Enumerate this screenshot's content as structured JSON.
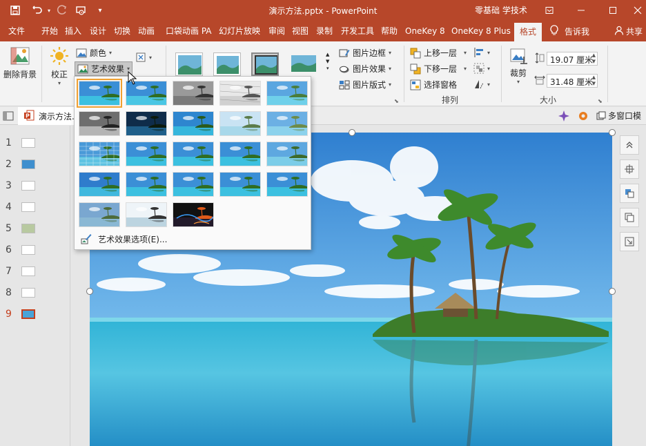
{
  "app": {
    "doc_title": "演示方法.pptx  -  PowerPoint",
    "user": "零基础 学技术"
  },
  "tabs": [
    {
      "label": "文件",
      "active": false
    },
    {
      "label": "开始",
      "active": false
    },
    {
      "label": "插入",
      "active": false
    },
    {
      "label": "设计",
      "active": false
    },
    {
      "label": "切换",
      "active": false
    },
    {
      "label": "动画",
      "active": false
    },
    {
      "label": "口袋动画 PA",
      "active": false
    },
    {
      "label": "幻灯片放映",
      "active": false
    },
    {
      "label": "审阅",
      "active": false
    },
    {
      "label": "视图",
      "active": false
    },
    {
      "label": "录制",
      "active": false
    },
    {
      "label": "开发工具",
      "active": false
    },
    {
      "label": "帮助",
      "active": false
    },
    {
      "label": "OneKey 8",
      "active": false
    },
    {
      "label": "OneKey 8 Plus",
      "active": false
    },
    {
      "label": "格式",
      "active": true
    }
  ],
  "tellme": "告诉我",
  "share": "共享",
  "ribbon": {
    "remove_bg": "删除背景",
    "corrections": "校正",
    "color": "颜色",
    "artistic": "艺术效果",
    "picture_border": "图片边框",
    "picture_effects": "图片效果",
    "picture_layout": "图片版式",
    "bring_forward": "上移一层",
    "send_backward": "下移一层",
    "selection_pane": "选择窗格",
    "arrange_label": "排列",
    "crop": "裁剪",
    "height": "19.07 厘米",
    "width": "31.48 厘米",
    "size_label": "大小"
  },
  "subbar": {
    "doc_tab": "演示方法.p",
    "multiwindow": "多窗口模"
  },
  "slides": [
    {
      "num": "1",
      "active": false
    },
    {
      "num": "2",
      "active": false
    },
    {
      "num": "3",
      "active": false
    },
    {
      "num": "4",
      "active": false
    },
    {
      "num": "5",
      "active": false
    },
    {
      "num": "6",
      "active": false
    },
    {
      "num": "7",
      "active": false
    },
    {
      "num": "8",
      "active": false
    },
    {
      "num": "9",
      "active": true
    }
  ],
  "dropdown": {
    "options_label": "艺术效果选项(E)...",
    "effect_count": 23,
    "selected_index": 0
  },
  "colors": {
    "accent": "#b7472a",
    "active_slide": "#c43e1c",
    "hover_outline": "#f0a030"
  }
}
